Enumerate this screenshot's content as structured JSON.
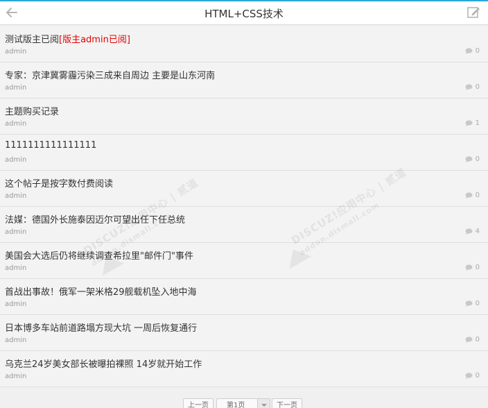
{
  "header": {
    "title": "HTML+CSS技术",
    "back_icon": "arrow-left-icon",
    "edit_icon": "edit-icon",
    "accent_color": "#2aa7dc"
  },
  "threads": [
    {
      "title": "测试版主已阅",
      "tag": "[版主admin已阅]",
      "author": "admin",
      "replies": "0"
    },
    {
      "title": "专家：京津冀雾霾污染三成来自周边 主要是山东河南",
      "tag": "",
      "author": "admin",
      "replies": "0"
    },
    {
      "title": "主题购买记录",
      "tag": "",
      "author": "admin",
      "replies": "1"
    },
    {
      "title": "1111111111111111",
      "tag": "",
      "author": "admin",
      "replies": "0"
    },
    {
      "title": "这个帖子是按字数付费阅读",
      "tag": "",
      "author": "admin",
      "replies": "0"
    },
    {
      "title": "法媒：德国外长施泰因迈尔可望出任下任总统",
      "tag": "",
      "author": "admin",
      "replies": "4"
    },
    {
      "title": "美国会大选后仍将继续调查希拉里\"邮件门\"事件",
      "tag": "",
      "author": "admin",
      "replies": "0"
    },
    {
      "title": "首战出事故！俄军一架米格29舰载机坠入地中海",
      "tag": "",
      "author": "admin",
      "replies": "0"
    },
    {
      "title": "日本博多车站前道路塌方现大坑 一周后恢复通行",
      "tag": "",
      "author": "admin",
      "replies": "0"
    },
    {
      "title": "乌克兰24岁美女部长被曝拍裸照 14岁就开始工作",
      "tag": "",
      "author": "admin",
      "replies": "0"
    }
  ],
  "watermark": {
    "brand": "DISCUZ!应用中心 | 贰道",
    "url": "addon.dismall.com"
  },
  "pager": {
    "prev": "上一页",
    "current": "第1页",
    "next": "下一页"
  }
}
